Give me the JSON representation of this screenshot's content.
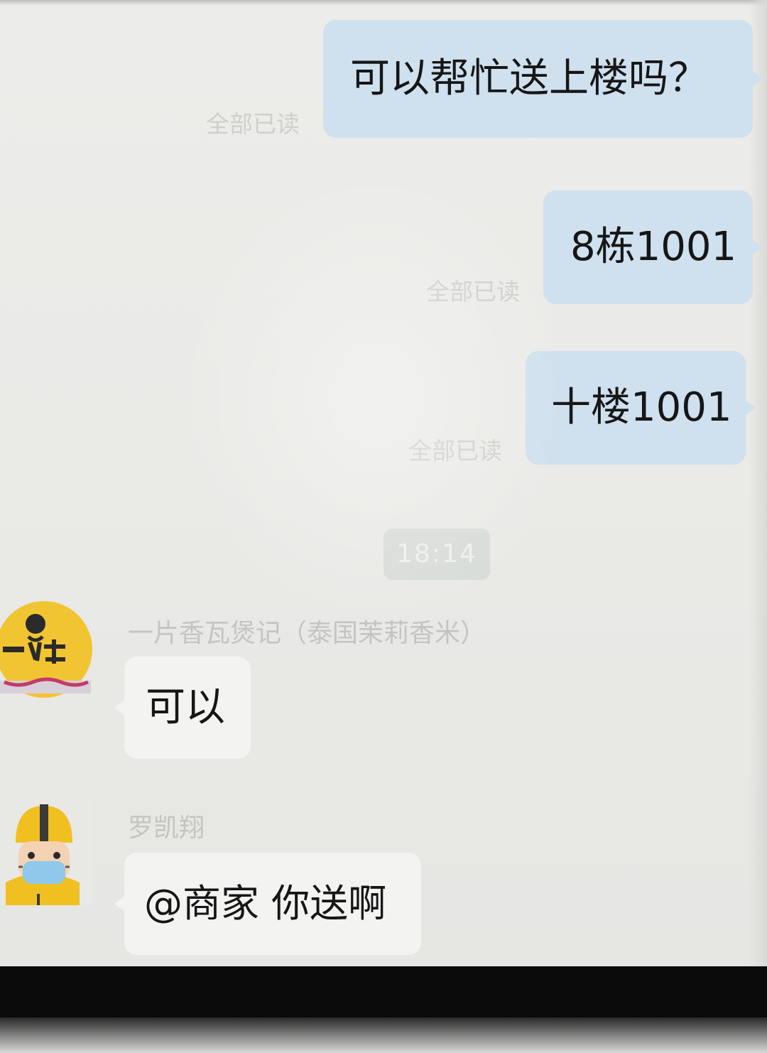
{
  "chat": {
    "messages_out": [
      {
        "text": "可以帮忙送上楼吗？",
        "read_status": "全部已读"
      },
      {
        "text": "8栋1001",
        "read_status": "全部已读"
      },
      {
        "text": "十楼1001",
        "read_status": "全部已读"
      }
    ],
    "timestamp": "18:14",
    "messages_in": [
      {
        "sender": "一片香瓦煲记（泰国茉莉香米）",
        "avatar_icon": "merchant-logo-icon",
        "text": "可以"
      },
      {
        "sender": "罗凯翔",
        "avatar_icon": "courier-avatar-icon",
        "text": "@商家 你送啊"
      }
    ]
  },
  "colors": {
    "outgoing_bubble": "#cfe0ee",
    "incoming_bubble": "#f3f3f1",
    "merchant_logo_yellow": "#f1c531",
    "courier_helmet_yellow": "#f0c020"
  }
}
